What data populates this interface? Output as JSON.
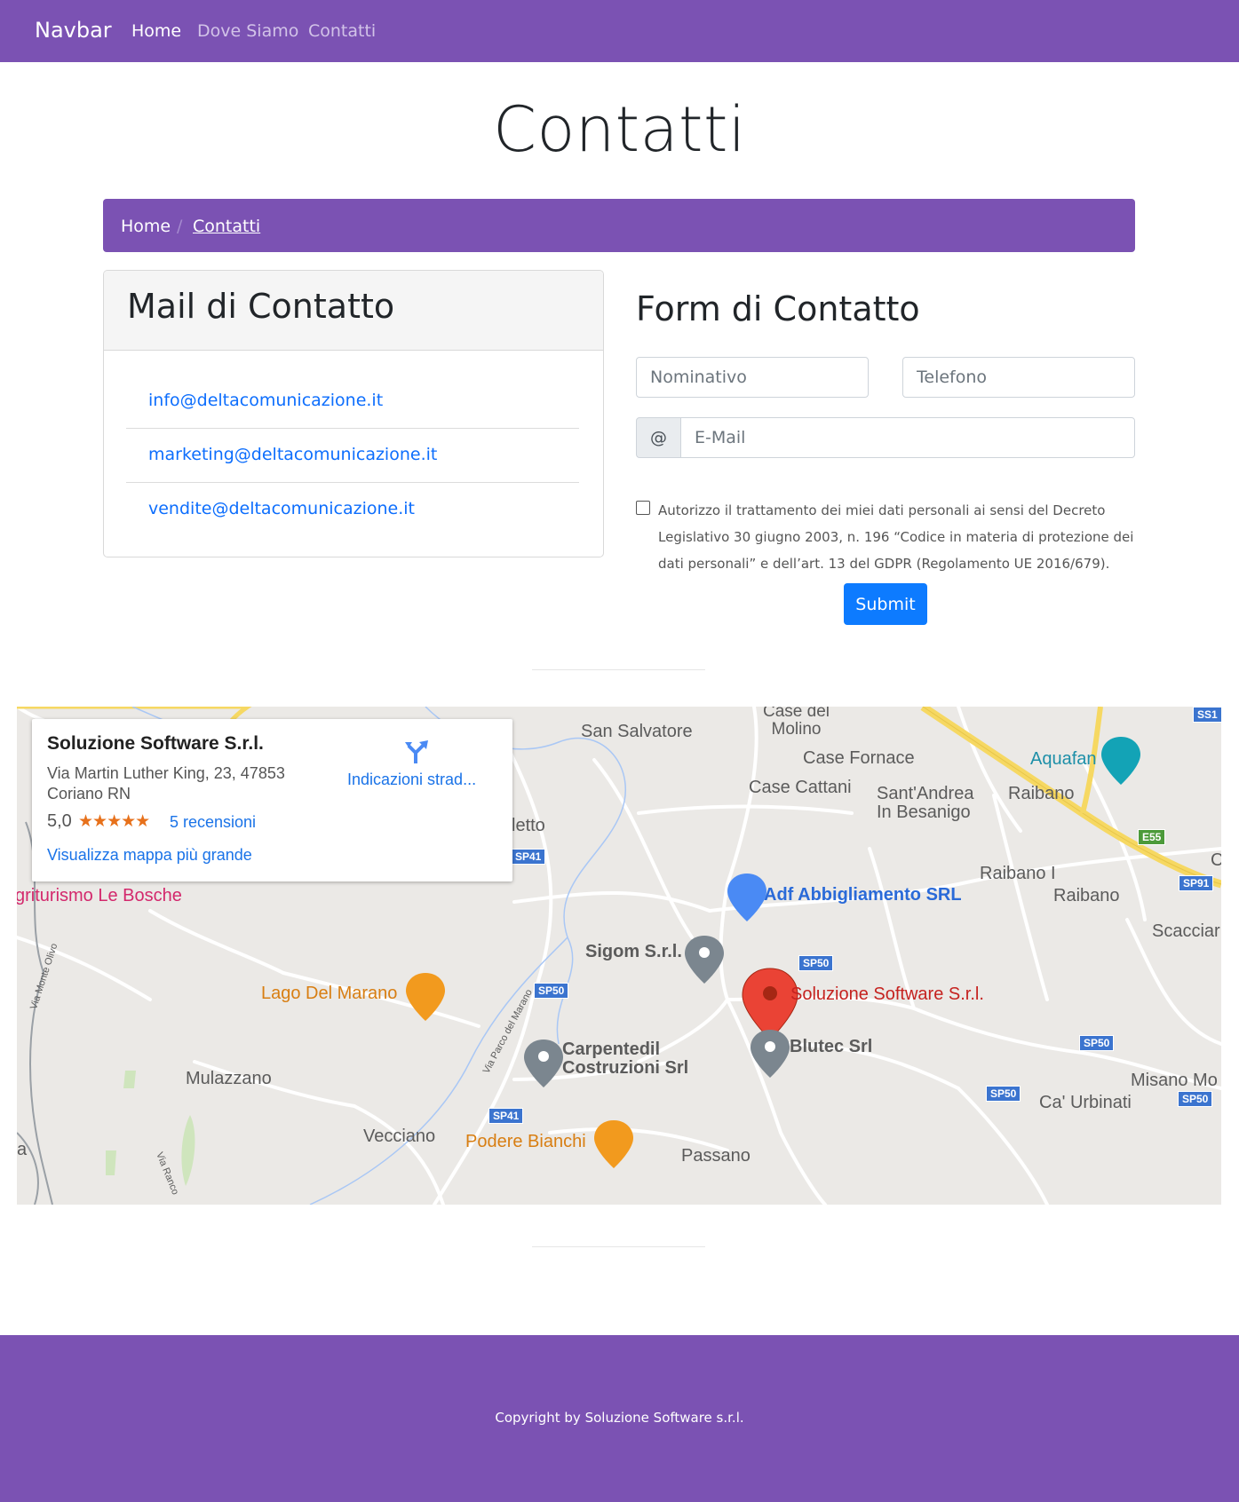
{
  "navbar": {
    "brand": "Navbar",
    "links": [
      "Home",
      "Dove Siamo",
      "Contatti"
    ]
  },
  "page": {
    "title": "Contatti"
  },
  "breadcrumb": {
    "home": "Home",
    "separator": "/",
    "current": "Contatti"
  },
  "mail_card": {
    "title": "Mail di Contatto",
    "emails": [
      "info@deltacomunicazione.it",
      "marketing@deltacomunicazione.it",
      "vendite@deltacomunicazione.it"
    ]
  },
  "form": {
    "title": "Form di Contatto",
    "name_placeholder": "Nominativo",
    "phone_placeholder": "Telefono",
    "email_prefix": "@",
    "email_placeholder": "E-Mail",
    "consent": "Autorizzo il trattamento dei miei dati personali ai sensi del Decreto Legislativo 30 giugno 2003, n. 196 “Codice in materia di protezione dei dati personali” e dell’art. 13 del GDPR (Regolamento UE 2016/679).",
    "submit": "Submit"
  },
  "map": {
    "info_card": {
      "name": "Soluzione Software S.r.l.",
      "address": "Via Martin Luther King, 23, 47853 Coriano RN",
      "rating": "5,0",
      "stars": "★★★★★",
      "reviews": "5 recensioni",
      "bigger_map": "Visualizza mappa più grande",
      "directions": "Indicazioni strad..."
    },
    "labels": {
      "san_salvatore": "San Salvatore",
      "case_del_molino": "Case del\nMolino",
      "case_fornace": "Case Fornace",
      "case_cattani": "Case Cattani",
      "sant_andrea": "Sant'Andrea\nIn Besanigo",
      "aquafan": "Aquafan",
      "raibano": "Raibano",
      "raibano_i": "Raibano I",
      "raibano_2": "Raibano",
      "scacciar": "Scacciar",
      "agriturismo": "griturismo Le Bosche",
      "letto": "letto",
      "adf": "Adf Abbigliamento SRL",
      "sigom": "Sigom S.r.l.",
      "soluzione": "Soluzione Software S.r.l.",
      "lago": "Lago Del Marano",
      "blutec": "Blutec Srl",
      "carpentedil": "Carpentedil\nCostruzioni Srl",
      "mulazzano": "Mulazzano",
      "vecciano": "Vecciano",
      "podere": "Podere Bianchi",
      "passano": "Passano",
      "misano": "Misano Mo",
      "ca_urbinati": "Ca' Urbinati",
      "via_monte_olivo": "Via Monte Olivo",
      "via_parco": "Via Parco del Marano",
      "via_ranco": "Via Ranco",
      "edge_a": "a",
      "edge_c": "C"
    },
    "shields": {
      "ss1": "SS1",
      "e55": "E55",
      "sp91": "SP91",
      "sp41_top": "SP41",
      "sp50_a": "SP50",
      "sp50_b": "SP50",
      "sp50_c": "SP50",
      "sp50_d": "SP50",
      "sp50_e": "SP50",
      "sp41_bottom": "SP41"
    }
  },
  "footer": {
    "copyright": "Copyright by Soluzione Software s.r.l."
  }
}
